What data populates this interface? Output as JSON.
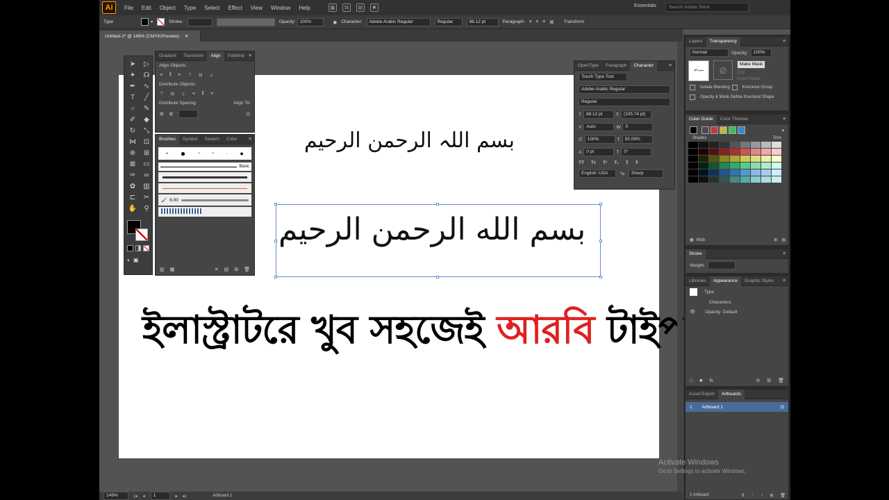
{
  "app": {
    "logo": "Ai",
    "menus": [
      "File",
      "Edit",
      "Object",
      "Type",
      "Select",
      "Effect",
      "View",
      "Window",
      "Help"
    ],
    "workspace": "Essentials",
    "stock_search_placeholder": "Search Adobe Stock"
  },
  "control_bar": {
    "type_label": "Type",
    "stroke_label": "Stroke:",
    "opacity_label": "Opacity:",
    "opacity_value": "100%",
    "character_label": "Character:",
    "font_family": "Adobe Arabic Regular",
    "font_style": "Regular",
    "font_size": "88.12 pt",
    "paragraph_label": "Paragraph:",
    "transform_label": "Transform"
  },
  "document": {
    "tab_title": "Untitled-2* @ 149% (CMYK/Preview)",
    "latin_transliteration": "بسم اللہ الرحمن الرحيم",
    "arabic_text": "بسم الله الرحمن الرحيم",
    "bangla_black_1": "ইলাস্ট্রাটরে খুব সহজেই ",
    "bangla_red": "আরবি",
    "bangla_black_2": " টাইপ করুন।"
  },
  "align_panel": {
    "tabs": [
      "Gradient",
      "Transform",
      "Align",
      "Pathfind"
    ],
    "align_objects": "Align Objects:",
    "distribute_objects": "Distribute Objects:",
    "distribute_spacing": "Distribute Spacing:",
    "align_to": "Align To:"
  },
  "brushes_panel": {
    "tabs": [
      "Brushes",
      "Symbol",
      "Swatch",
      "Color"
    ],
    "basic_label": "Basic",
    "brush_size": "6.00"
  },
  "character_panel": {
    "tabs": [
      "OpenType",
      "Paragraph",
      "Character"
    ],
    "touch_type": "Touch Type Tool",
    "font_family": "Adobe Arabic Regular",
    "font_style": "Regular",
    "size": "88.12 pt",
    "leading": "(105.74 pt)",
    "kerning": "Auto",
    "tracking": "0",
    "vscale": "100%",
    "hscale": "92.09%",
    "baseline": "0 pt",
    "rotation": "0°",
    "language": "English: USA",
    "aa": "Sharp"
  },
  "transparency_panel": {
    "tabs": [
      "Layers",
      "Transparency"
    ],
    "blend_mode": "Normal",
    "opacity_label": "Opacity:",
    "opacity": "100%",
    "make_mask": "Make Mask",
    "clip": "Clip",
    "invert_mask": "Invert Mask",
    "isolate_blending": "Isolate Blending",
    "knockout_group": "Knockout Group",
    "opacity_mask_define": "Opacity & Mask Define Knockout Shape"
  },
  "color_guide": {
    "tabs": [
      "Color Guide",
      "Color Themes"
    ],
    "shades": "Shades",
    "tints": "Tints",
    "web": "Web"
  },
  "stroke_panel": {
    "title": "Stroke",
    "weight_label": "Weight:"
  },
  "appearance_panel": {
    "tabs": [
      "Libraries",
      "Appearance",
      "Graphic Styles"
    ],
    "type_row": "Type",
    "characters_row": "Characters",
    "opacity_row": "Opacity:",
    "opacity_value": "Default"
  },
  "artboards_panel": {
    "tabs": [
      "Asset Export",
      "Artboards"
    ],
    "item_number": "1",
    "item_name": "Artboard 1",
    "footer": "1 Artboard"
  },
  "status_bar": {
    "zoom": "149%",
    "page": "1",
    "artboard_name": "Artboard 1"
  },
  "watermark": {
    "title": "Activate Windows",
    "subtitle": "Go to Settings to activate Windows."
  }
}
